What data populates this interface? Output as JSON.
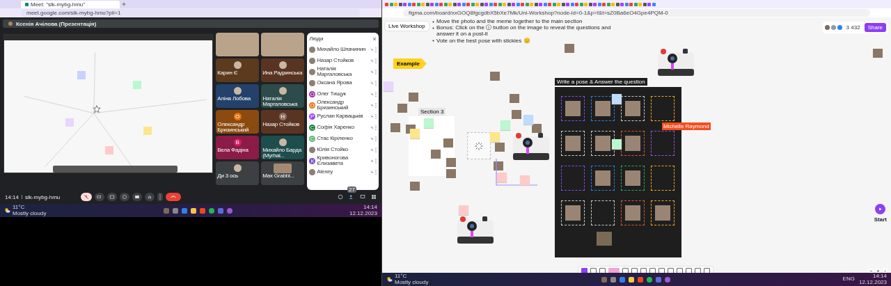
{
  "left": {
    "tab": {
      "title": "Meet: \"slk-mybg-hmu\""
    },
    "url": "meet.google.com/slk-mybg-hmu?pli=1",
    "presenter": "Ксенія Ачілова (Презентація)",
    "shared_stickies": [
      {
        "color": "#c7d2fe"
      },
      {
        "color": "#bbf7d0"
      },
      {
        "color": "#e9d5ff"
      },
      {
        "color": "#fde68a"
      },
      {
        "color": "#fecaca"
      }
    ],
    "tiles": [
      {
        "kind": "photo"
      },
      {
        "kind": "photo"
      },
      {
        "name": "Карин Є",
        "kind": "round-photo",
        "color": "#5b3a1e"
      },
      {
        "name": "Ина Радзинська",
        "kind": "round-photo",
        "color": "#5a3422"
      },
      {
        "name": "Аліна Лобова",
        "kind": "round-photo",
        "color": "#23416b"
      },
      {
        "name": "Наталія Маргаловська",
        "kind": "round-photo",
        "color": "#2d4b4b"
      },
      {
        "name": "Олександр Бризинський",
        "kind": "initial",
        "color": "#8a4a10",
        "avatar": {
          "initial": "О",
          "color": "#e8710a"
        }
      },
      {
        "name": "Назар Стойков",
        "kind": "initial",
        "color": "#5a3422",
        "avatar": {
          "initial": "Н",
          "color": "#8d6e63"
        }
      },
      {
        "name": "Вела Фадіна",
        "kind": "initial",
        "color": "#8a1c47",
        "avatar": {
          "initial": "В",
          "color": "#d81b60"
        }
      },
      {
        "name": "Михайло Барда (Myrhal...",
        "kind": "round-photo",
        "color": "#1e4d4d"
      },
      {
        "name": "Ди 3 ось",
        "kind": "round-photo",
        "color": "#3c4043"
      },
      {
        "name": "Max Grabbl...",
        "kind": "photo",
        "color": "#3c4043"
      }
    ],
    "people": {
      "title": "Люди",
      "items": [
        {
          "name": "Михайло Шпачинин",
          "kind": "photo"
        },
        {
          "name": "Назар Стойков",
          "kind": "photo"
        },
        {
          "name": "Наталія Маргаловська",
          "kind": "photo"
        },
        {
          "name": "Оксана Ярова",
          "kind": "photo"
        },
        {
          "name": "Олег Тищук",
          "kind": "initial",
          "initial": "О",
          "color": "#9c27b0"
        },
        {
          "name": "Олександр Бризинський",
          "kind": "initial",
          "initial": "О",
          "color": "#e8710a"
        },
        {
          "name": "Руслан Карвацьків",
          "kind": "initial",
          "initial": "Р",
          "color": "#a142f4"
        },
        {
          "name": "Софія Харенко",
          "kind": "initial",
          "initial": "С",
          "color": "#188038"
        },
        {
          "name": "Стас Кіріленко",
          "kind": "initial",
          "initial": "С",
          "color": "#5bb974"
        },
        {
          "name": "Юлія Стойко",
          "kind": "photo"
        },
        {
          "name": "Кривоногова Єлизавета",
          "kind": "initial",
          "initial": "К",
          "color": "#7b4bd6"
        },
        {
          "name": "Alexey",
          "kind": "photo"
        }
      ]
    },
    "meeting": {
      "time": "14:14",
      "code": "slk-mybg-hmu"
    },
    "participants_badge": "27",
    "taskbar": {
      "temp": "11°C",
      "weather": "Mostly cloudy",
      "time": "14:14",
      "date": "12.12.2023"
    }
  },
  "right": {
    "url": "figma.com/board/xxGOQ8fgcgdbX5bXe7Mk/Uni-Workshop?node-id=0-1&p=f&t=sZ0Ba6eO4Gpe4PQM-0",
    "file": "Live Workshop",
    "instructions": [
      "Move the photo and the meme together to the main section",
      "Bonus:  Click on the ⓘ button on the image to reveal the questions and answer it on a post-it",
      "Vote on the best pose with stickies 😊"
    ],
    "share": "Share",
    "zoom": "3 432",
    "example": "Example",
    "section": "Section 3",
    "frame_title": "Write a pose & Answer the question",
    "cursor_label": "Michelle Raymond",
    "stickies": [
      {
        "color": "#e9d5ff"
      },
      {
        "color": "#fde68a"
      },
      {
        "color": "#bbf7d0"
      },
      {
        "color": "#bfdbfe"
      },
      {
        "color": "#bbf7d0"
      },
      {
        "color": "#fde68a"
      },
      {
        "color": "#fecaca"
      },
      {
        "color": "#fecaca"
      },
      {
        "color": "#fecaca"
      },
      {
        "color": "#bfdbfe"
      },
      {
        "color": "#bbf7d0"
      }
    ],
    "slots": [
      {
        "color": "#7c4dff",
        "photo": true
      },
      {
        "color": "#2f80ed",
        "photo": true
      },
      {
        "color": "#cccccc",
        "photo": true
      },
      {
        "color": "#f2a91e",
        "photo": false
      },
      {
        "color": "#cccccc",
        "photo": true
      },
      {
        "color": "#cccccc",
        "photo": true
      },
      {
        "color": "#e0582f",
        "photo": true
      },
      {
        "color": "#9b51e0",
        "photo": false
      },
      {
        "color": "#7c4dff",
        "photo": false
      },
      {
        "color": "#2f80ed",
        "photo": true
      },
      {
        "color": "#27ae60",
        "photo": true
      },
      {
        "color": "#f2a91e",
        "photo": false
      },
      {
        "color": "#cccccc",
        "photo": true
      },
      {
        "color": "#cccccc",
        "photo": false
      },
      {
        "color": "#e0582f",
        "photo": true
      },
      {
        "color": "#f2a91e",
        "photo": true
      }
    ],
    "start": "Start",
    "taskbar": {
      "temp": "11°C",
      "weather": "Mostly cloudy",
      "lang": "ENG",
      "time": "14:14",
      "date": "12.12.2023"
    }
  }
}
